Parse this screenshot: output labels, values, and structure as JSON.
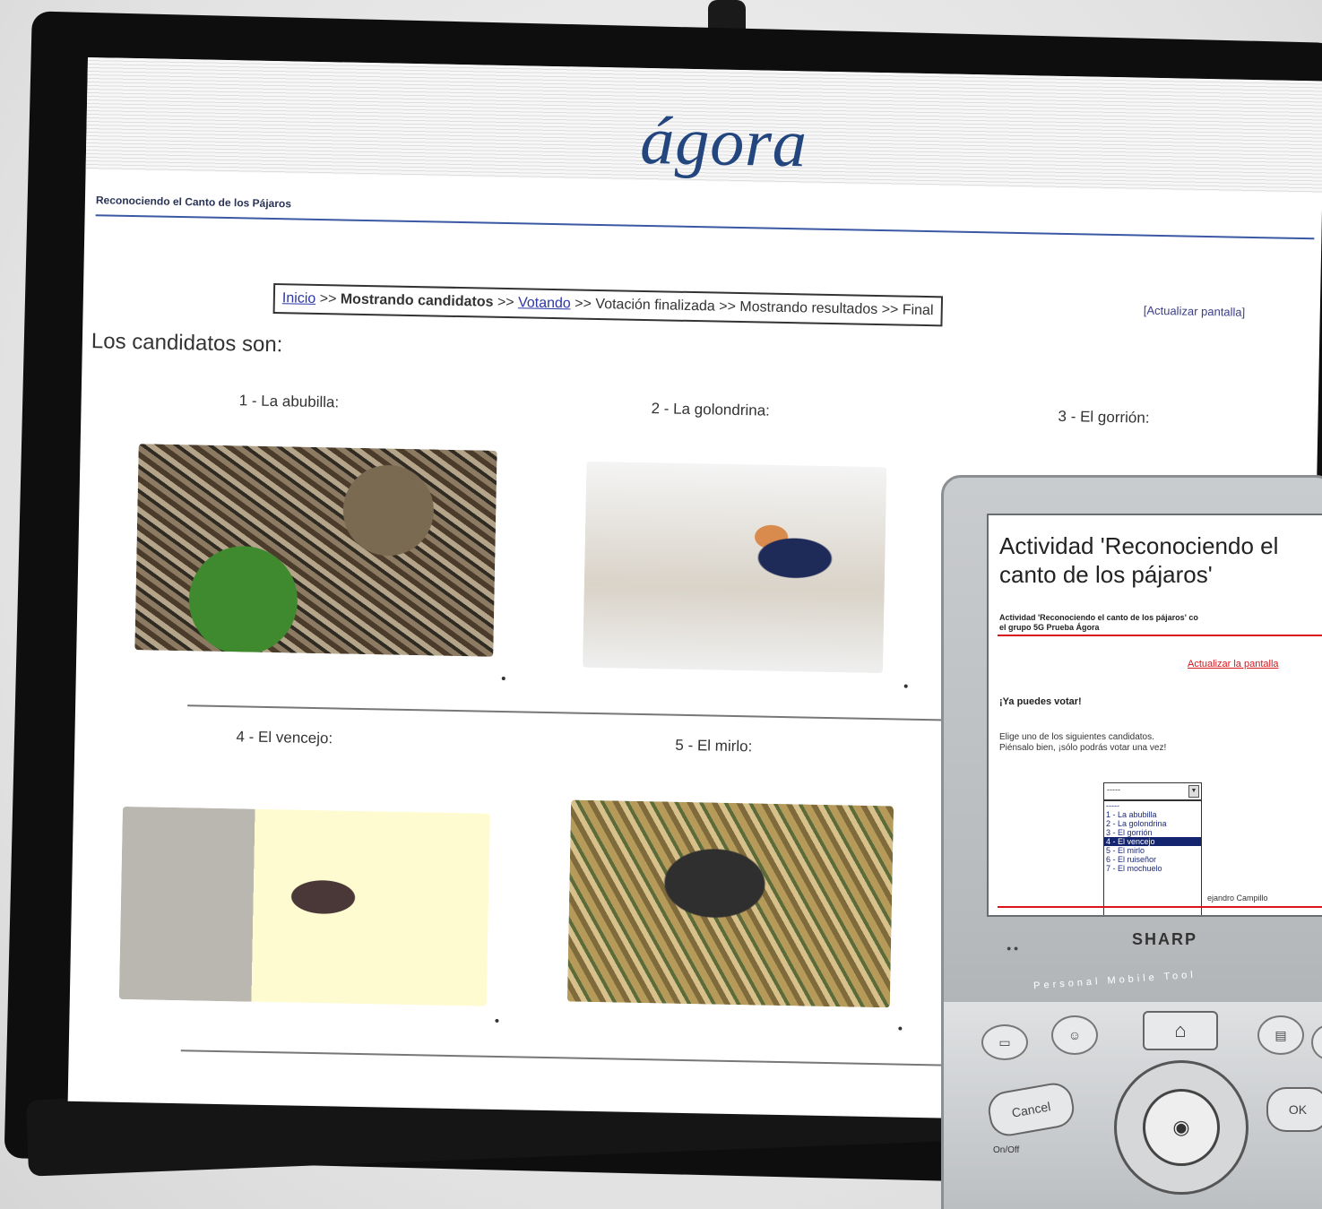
{
  "web": {
    "logo": "ágora",
    "subtitle": "Reconociendo el Canto de los Pájaros",
    "refresh": "[Actualizar pantalla]",
    "breadcrumb": {
      "inicio": "Inicio",
      "sep": ">>",
      "mostrando": "Mostrando candidatos",
      "votando": "Votando",
      "finalizada": "Votación finalizada",
      "resultados": "Mostrando resultados",
      "final": "Final"
    },
    "candidates_title": "Los candidatos son:",
    "candidates": [
      {
        "label": "1 - La abubilla:"
      },
      {
        "label": "2 - La golondrina:"
      },
      {
        "label": "3 - El gorrión:"
      },
      {
        "label": "4 - El vencejo:"
      },
      {
        "label": "5 - El mirlo:"
      }
    ]
  },
  "pda": {
    "title": "Actividad 'Reconociendo el canto de los pájaros'",
    "line1": "Actividad 'Reconociendo el canto de los pájaros' co",
    "line2": "el grupo 5G Prueba Ágora",
    "update_link": "Actualizar la pantalla",
    "vote_now": "¡Ya puedes votar!",
    "choose_line1": "Elige uno de los siguientes candidatos.",
    "choose_line2": "Piénsalo bien, ¡sólo podrás votar una vez!",
    "select_value": "-----",
    "options": [
      "-----",
      "1 - La abubilla",
      "2 - La golondrina",
      "3 - El gorrión",
      "4 - El vencejo",
      "5 - El mirlo",
      "6 - El ruiseñor",
      "7 - El mochuelo"
    ],
    "selected_option": "4 - El vencejo",
    "author": "ejandro Campillo",
    "brand": "SHARP",
    "tagline": "Personal Mobile Tool",
    "cancel": "Cancel",
    "ok": "OK",
    "onoff": "On/Off"
  }
}
